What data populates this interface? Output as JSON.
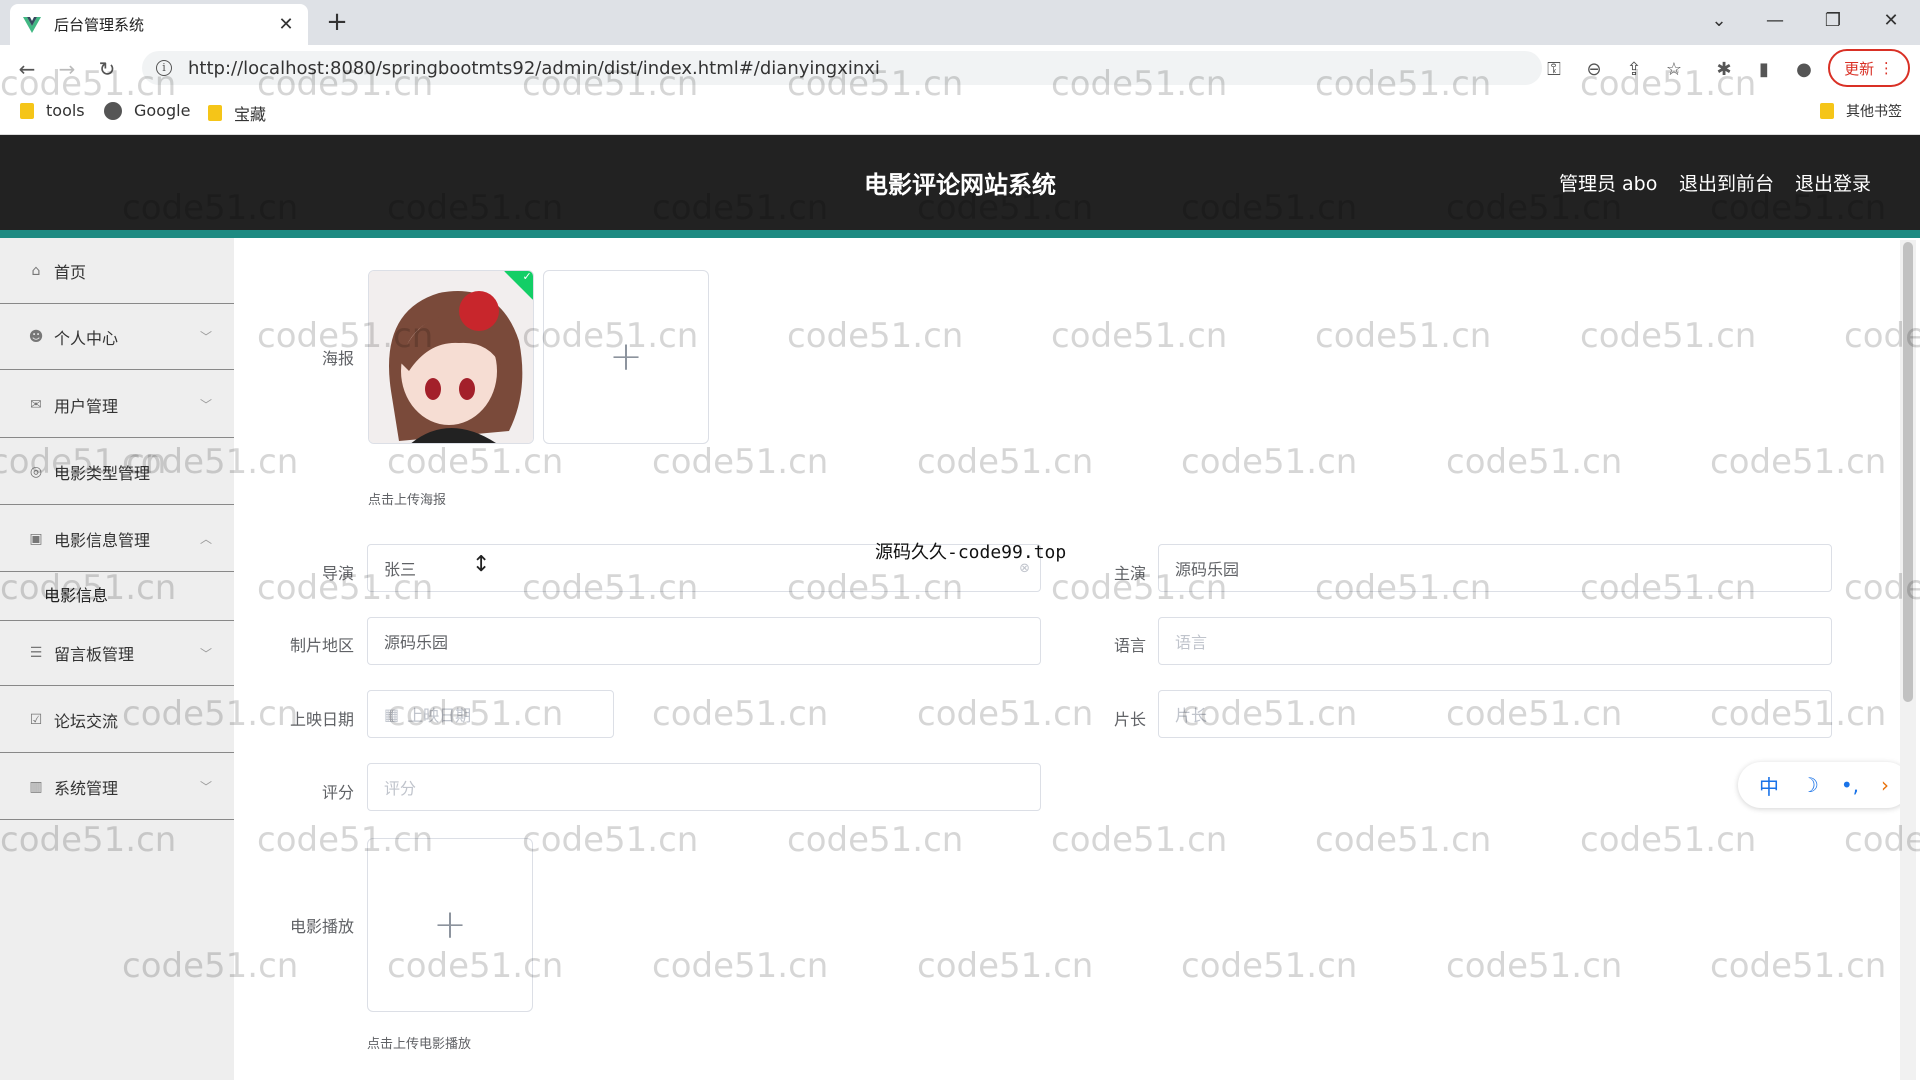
{
  "browser": {
    "tab_title": "后台管理系统",
    "url": "http://localhost:8080/springbootmts92/admin/dist/index.html#/dianyingxinxi",
    "update_label": "更新",
    "bookmarks": [
      "tools",
      "Google",
      "宝藏"
    ],
    "other_bookmarks": "其他书签"
  },
  "header": {
    "title": "电影评论网站系统",
    "admin_label": "管理员 abo",
    "back_to_front": "退出到前台",
    "logout": "退出登录"
  },
  "sidebar": {
    "items": [
      {
        "label": "首页",
        "icon": "home-icon"
      },
      {
        "label": "个人中心",
        "icon": "user-icon"
      },
      {
        "label": "用户管理",
        "icon": "mail-icon"
      },
      {
        "label": "电影类型管理",
        "icon": "circle-icon"
      },
      {
        "label": "电影信息管理",
        "icon": "clipboard-icon"
      },
      {
        "label": "留言板管理",
        "icon": "list-icon"
      },
      {
        "label": "论坛交流",
        "icon": "check-icon"
      },
      {
        "label": "系统管理",
        "icon": "chart-icon"
      }
    ],
    "sub_item": "电影信息"
  },
  "form": {
    "poster_label": "海报",
    "poster_hint": "点击上传海报",
    "director_label": "导演",
    "director_value": "张三",
    "star_label": "主演",
    "star_value": "源码乐园",
    "region_label": "制片地区",
    "region_value": "源码乐园",
    "language_label": "语言",
    "language_placeholder": "语言",
    "date_label": "上映日期",
    "date_placeholder": "上映日期",
    "length_label": "片长",
    "length_placeholder": "片长",
    "score_label": "评分",
    "score_placeholder": "评分",
    "play_label": "电影播放",
    "play_hint": "点击上传电影播放"
  },
  "overlay_text": "源码久久-code99.top",
  "watermark": "code51.cn",
  "ime": {
    "mode": "中"
  }
}
